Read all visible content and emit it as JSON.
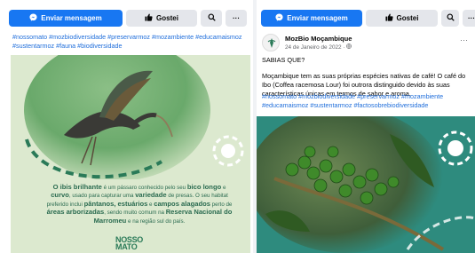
{
  "left_card": {
    "actions": {
      "message_label": "Enviar mensagem",
      "like_label": "Gostei",
      "more_label": "···"
    },
    "hashtags": "#nossomato #mozbiodiversidade #preservarmoz #mozambiente #educamaismoz #sustentarmoz #fauna #biodiversidade",
    "poster": {
      "lead": "O ibis brilhante",
      "text1": " é um pássaro conhecido pelo seu ",
      "bold1": "bico longo",
      "text2": " e ",
      "bold2": "curvo",
      "text3": ", usado para capturar uma ",
      "bold3": "variedade",
      "text4": " de presas. O seu habitat preferido inclui ",
      "bold4": "pântanos, estuários",
      "text5": " e ",
      "bold5": "campos alagados",
      "text6": " perto de ",
      "bold6": "áreas arborizadas",
      "text7": ", sendo muito comum na ",
      "bold7": "Reserva Nacional do Marromeu",
      "text8": " e na região sul do país.",
      "logo_line1": "NOSSO",
      "logo_line2": "MATO"
    }
  },
  "right_card": {
    "actions": {
      "message_label": "Enviar mensagem",
      "like_label": "Gostei",
      "more_label": "···"
    },
    "author": {
      "name": "MozBio Moçambique",
      "date": "24 de Janeiro de 2022 · "
    },
    "body": {
      "line1": "SABIAS QUE?",
      "line2": "Moçambique tem as suas próprias espécies nativas de café! O café do Ibo (Coffea racemosa Lour) foi outrora distinguido devido às suas características únicas em termos de sabor e aroma."
    },
    "hashtags": "#nossomato #mozbiodiversidade #preservarmoz #mozambiente #educamaismoz #sustentarmoz #factosobrebiodiversidade"
  },
  "colors": {
    "facebook_blue": "#1877f2",
    "hashtag_blue": "#216fdb",
    "poster_green": "#dce9cf",
    "poster_text_green": "#2a6b50",
    "coffee_teal": "#2e8b7e"
  },
  "icons": [
    "messenger-icon",
    "thumbs-up-icon",
    "search-icon",
    "more-icon",
    "globe-icon"
  ]
}
